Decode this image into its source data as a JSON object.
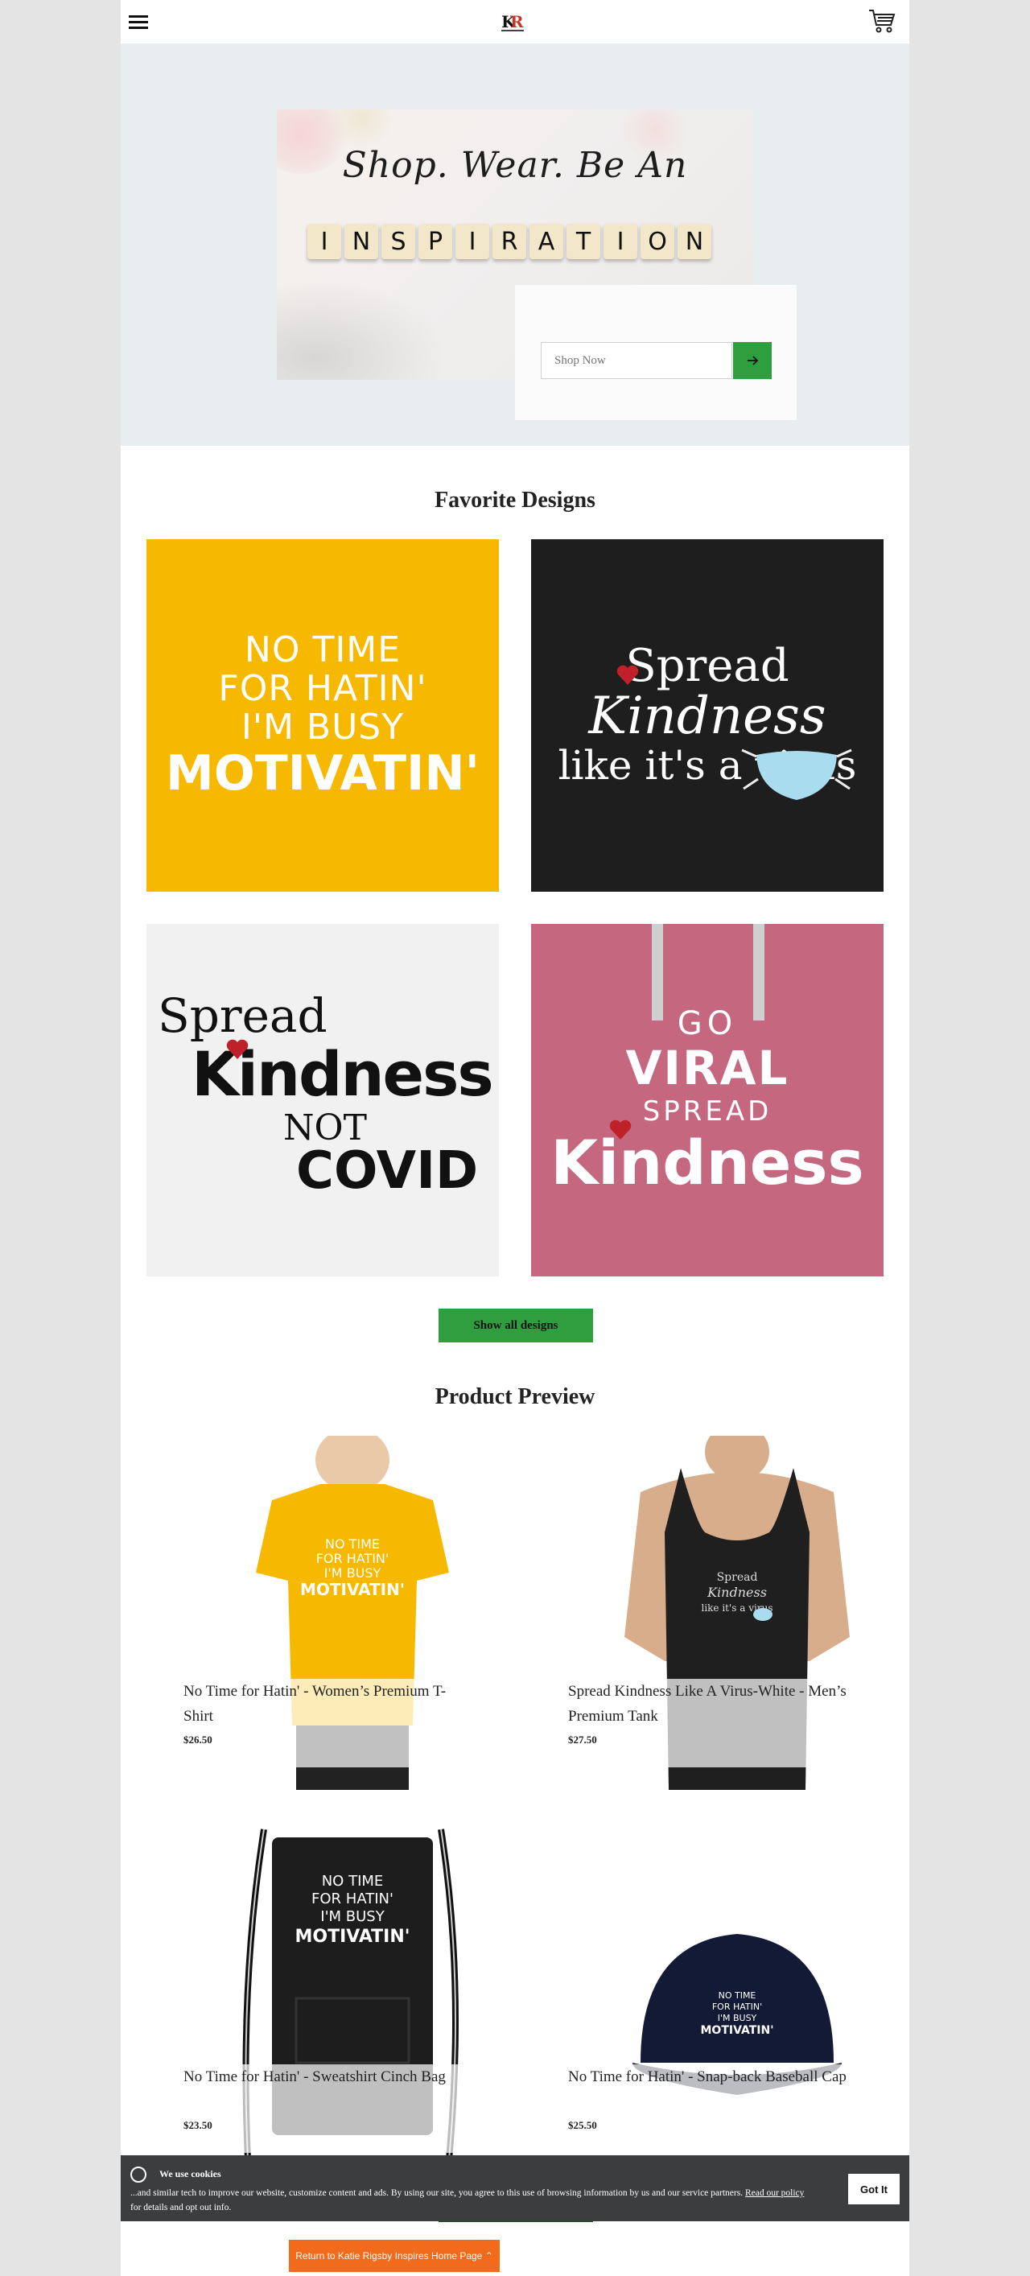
{
  "header": {
    "menu_icon": "hamburger-menu-icon",
    "logo_text": "KR",
    "cart_icon": "shopping-cart-icon"
  },
  "hero": {
    "headline": "Shop. Wear. Be An",
    "tiles": [
      "I",
      "N",
      "S",
      "P",
      "I",
      "R",
      "A",
      "T",
      "I",
      "O",
      "N"
    ],
    "search_placeholder": "Shop Now",
    "search_button_icon": "arrow-right-icon"
  },
  "favorites": {
    "title": "Favorite Designs",
    "designs": [
      {
        "lines": [
          "NO TIME",
          "FOR HATIN'",
          "I'M BUSY",
          "MOTIVATIN'"
        ]
      },
      {
        "lines": [
          "Spread",
          "Kindness",
          "like it's a virus"
        ]
      },
      {
        "lines": [
          "Spread",
          "Kindness",
          "NOT",
          "COVID"
        ]
      },
      {
        "lines": [
          "GO",
          "VIRAL",
          "SPREAD",
          "Kindness"
        ]
      }
    ],
    "show_all_label": "Show all designs"
  },
  "preview": {
    "title": "Product Preview",
    "products": [
      {
        "name": "No Time for Hatin' - Women’s Premium T-Shirt",
        "price": "$26.50"
      },
      {
        "name": "Spread Kindness Like A Virus-White - Men’s Premium Tank",
        "price": "$27.50"
      },
      {
        "name": "No Time for Hatin' - Sweatshirt Cinch Bag",
        "price": "$23.50"
      },
      {
        "name": "No Time for Hatin' - Snap-back Baseball Cap",
        "price": "$25.50"
      }
    ]
  },
  "cookie": {
    "title": "We use cookies",
    "text": "...and similar tech to improve our website, customize content and ads. By using our site, you agree to this use of browsing information by us and our service partners. ",
    "link": "Read our policy",
    "text_after": " for details and opt out info.",
    "button": "Got It"
  },
  "return_button": "Return to Katie Rigsby Inspires Home Page",
  "colors": {
    "accent_green": "#2f9e3f",
    "orange": "#f26a1b",
    "yellow": "#f7b900",
    "pink": "#c5687f"
  }
}
